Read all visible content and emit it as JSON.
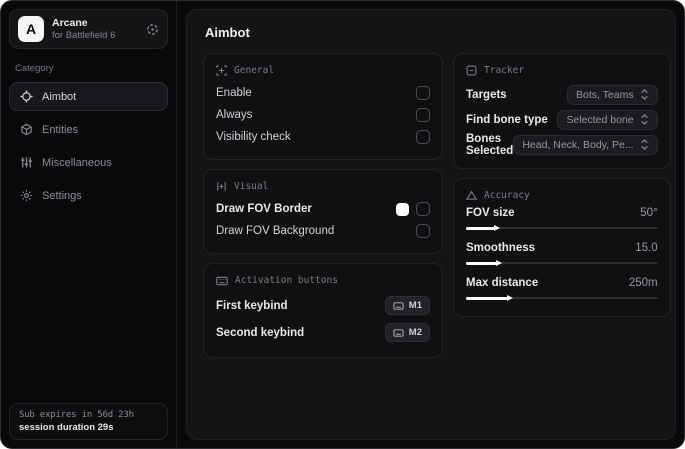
{
  "colors": {
    "window_bg": "#09090b",
    "main_bg": "#141417",
    "card_bg": "#101013",
    "accent": "#ffffff",
    "fov_border_swatch": "#ffffff"
  },
  "sidebar": {
    "logo": {
      "initial": "A",
      "title": "Arcane",
      "subtitle": "for Battlefield 6"
    },
    "category_label": "Category",
    "items": [
      {
        "label": "Aimbot",
        "icon": "crosshair-icon",
        "selected": true
      },
      {
        "label": "Entities",
        "icon": "entities-icon",
        "selected": false
      },
      {
        "label": "Miscellaneous",
        "icon": "equalizer-icon",
        "selected": false
      },
      {
        "label": "Settings",
        "icon": "gear-icon",
        "selected": false
      }
    ],
    "subscription": {
      "line1": "Sub expires in 56d 23h",
      "line2": "session duration 29s"
    }
  },
  "main": {
    "title": "Aimbot",
    "general": {
      "title": "General",
      "rows": [
        {
          "label": "Enable",
          "checked": false
        },
        {
          "label": "Always",
          "checked": false
        },
        {
          "label": "Visibility check",
          "checked": false
        }
      ]
    },
    "visual": {
      "title": "Visual",
      "rows": [
        {
          "label": "Draw FOV Border",
          "checked": false,
          "swatch": "#ffffff"
        },
        {
          "label": "Draw FOV Background",
          "checked": false
        }
      ]
    },
    "activation": {
      "title": "Activation buttons",
      "rows": [
        {
          "label": "First keybind",
          "key": "M1"
        },
        {
          "label": "Second keybind",
          "key": "M2"
        }
      ]
    },
    "tracker": {
      "title": "Tracker",
      "rows": [
        {
          "label": "Targets",
          "value": "Bots, Teams"
        },
        {
          "label": "Find bone type",
          "value": "Selected bone"
        },
        {
          "label": "Bones Selected",
          "value": "Head, Neck, Body, Pe..."
        }
      ]
    },
    "accuracy": {
      "title": "Accuracy",
      "sliders": [
        {
          "label": "FOV size",
          "value": "50°",
          "percent": 15
        },
        {
          "label": "Smoothness",
          "value": "15.0",
          "percent": 16
        },
        {
          "label": "Max distance",
          "value": "250m",
          "percent": 22
        }
      ]
    }
  }
}
